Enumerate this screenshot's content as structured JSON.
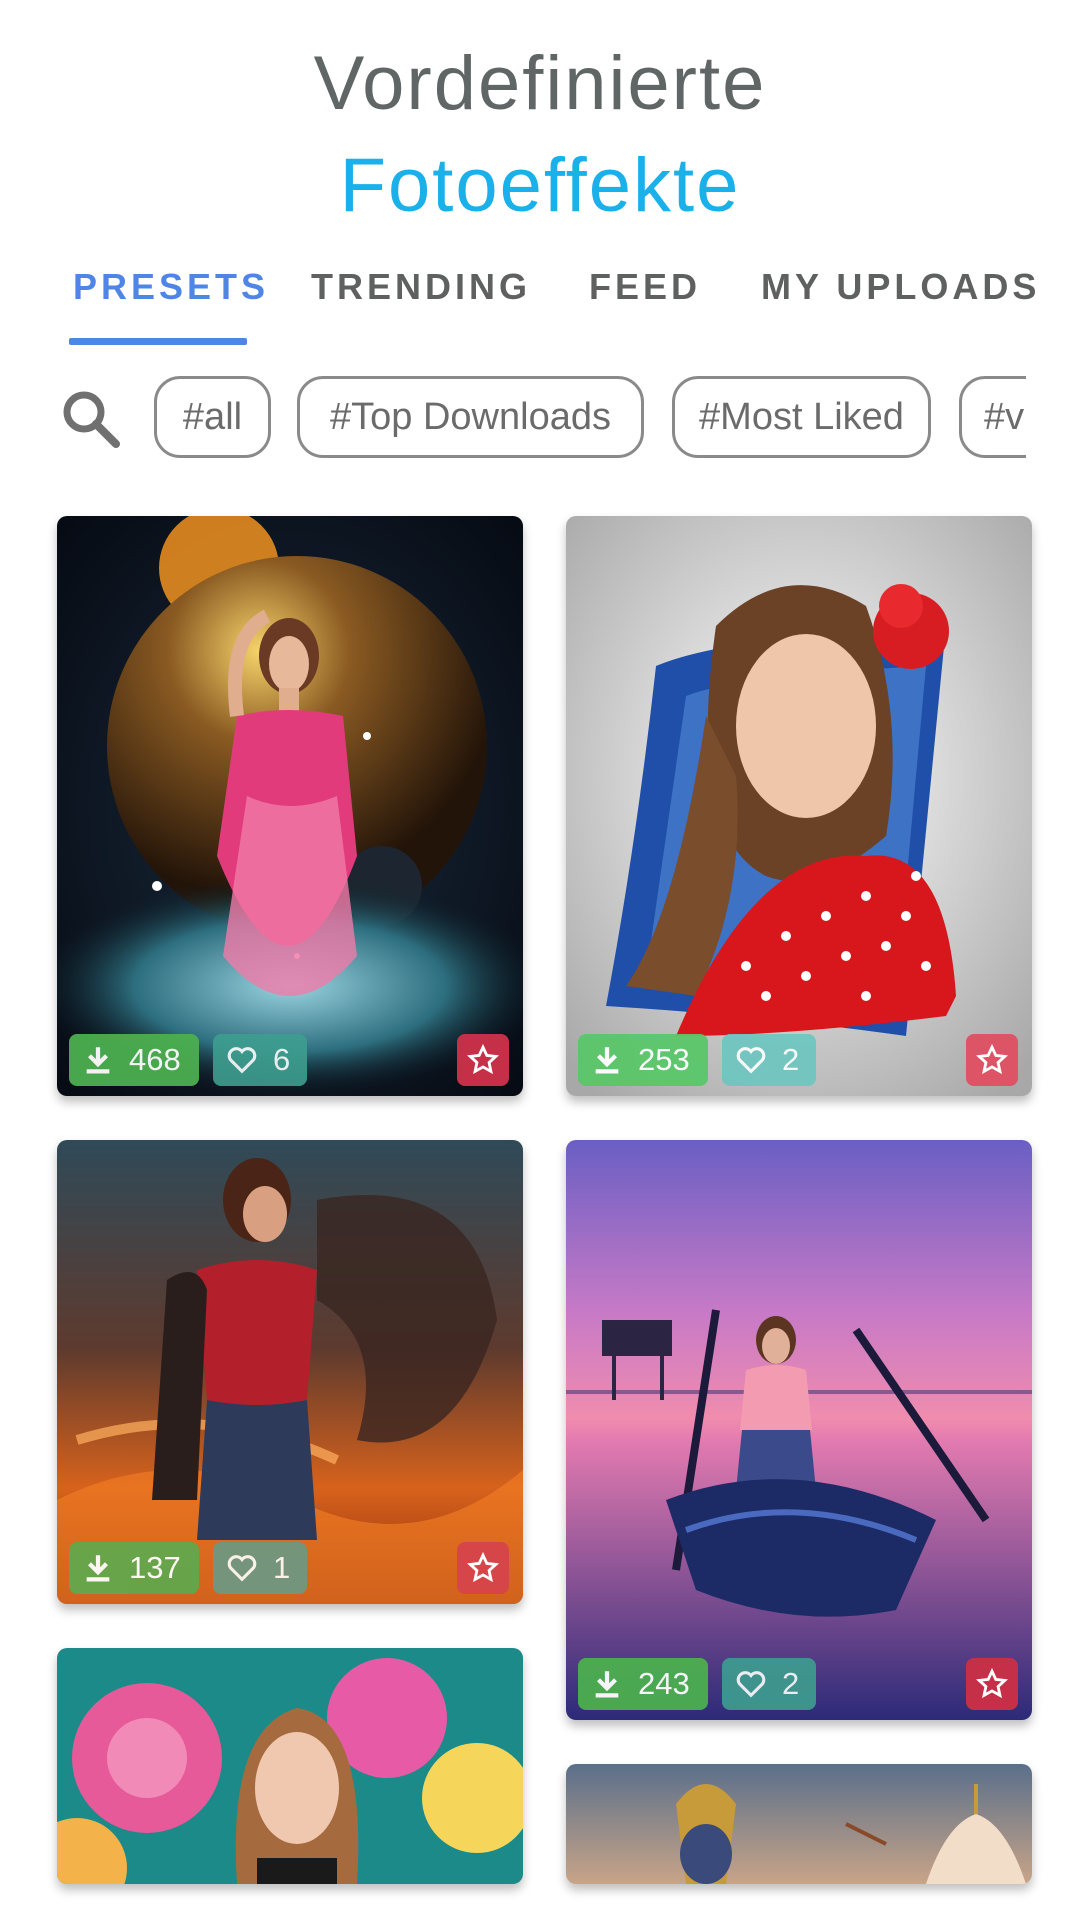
{
  "header": {
    "title_line1": "Vordefinierte",
    "title_line2": "Fotoeffekte"
  },
  "tabs": [
    {
      "label": "PRESETS",
      "active": true
    },
    {
      "label": "TRENDING",
      "active": false
    },
    {
      "label": "FEED",
      "active": false
    },
    {
      "label": "MY UPLOADS",
      "active": false
    }
  ],
  "filters": {
    "search_icon": "search-icon",
    "chips": [
      "#all",
      "#Top Downloads",
      "#Most Liked",
      "#v"
    ]
  },
  "cards": [
    {
      "scene": "space-planet-pink-dress",
      "downloads": "468",
      "likes": "6"
    },
    {
      "scene": "red-polka-dot-blue-brush",
      "downloads": "253",
      "likes": "2"
    },
    {
      "scene": "dragon-fire",
      "downloads": "137",
      "likes": "1"
    },
    {
      "scene": "boat-sunset-lake",
      "downloads": "243",
      "likes": "2"
    },
    {
      "scene": "flowers-portrait"
    },
    {
      "scene": "deity-temple"
    }
  ],
  "colors": {
    "accent": "#4f86e6",
    "title_blue": "#1ab0ea",
    "download_green": "#4caf50",
    "like_teal": "#3e9e8f",
    "favorite_red": "#c62f48"
  },
  "icons": {
    "download": "download-icon",
    "like": "heart-icon",
    "favorite": "star-icon"
  }
}
